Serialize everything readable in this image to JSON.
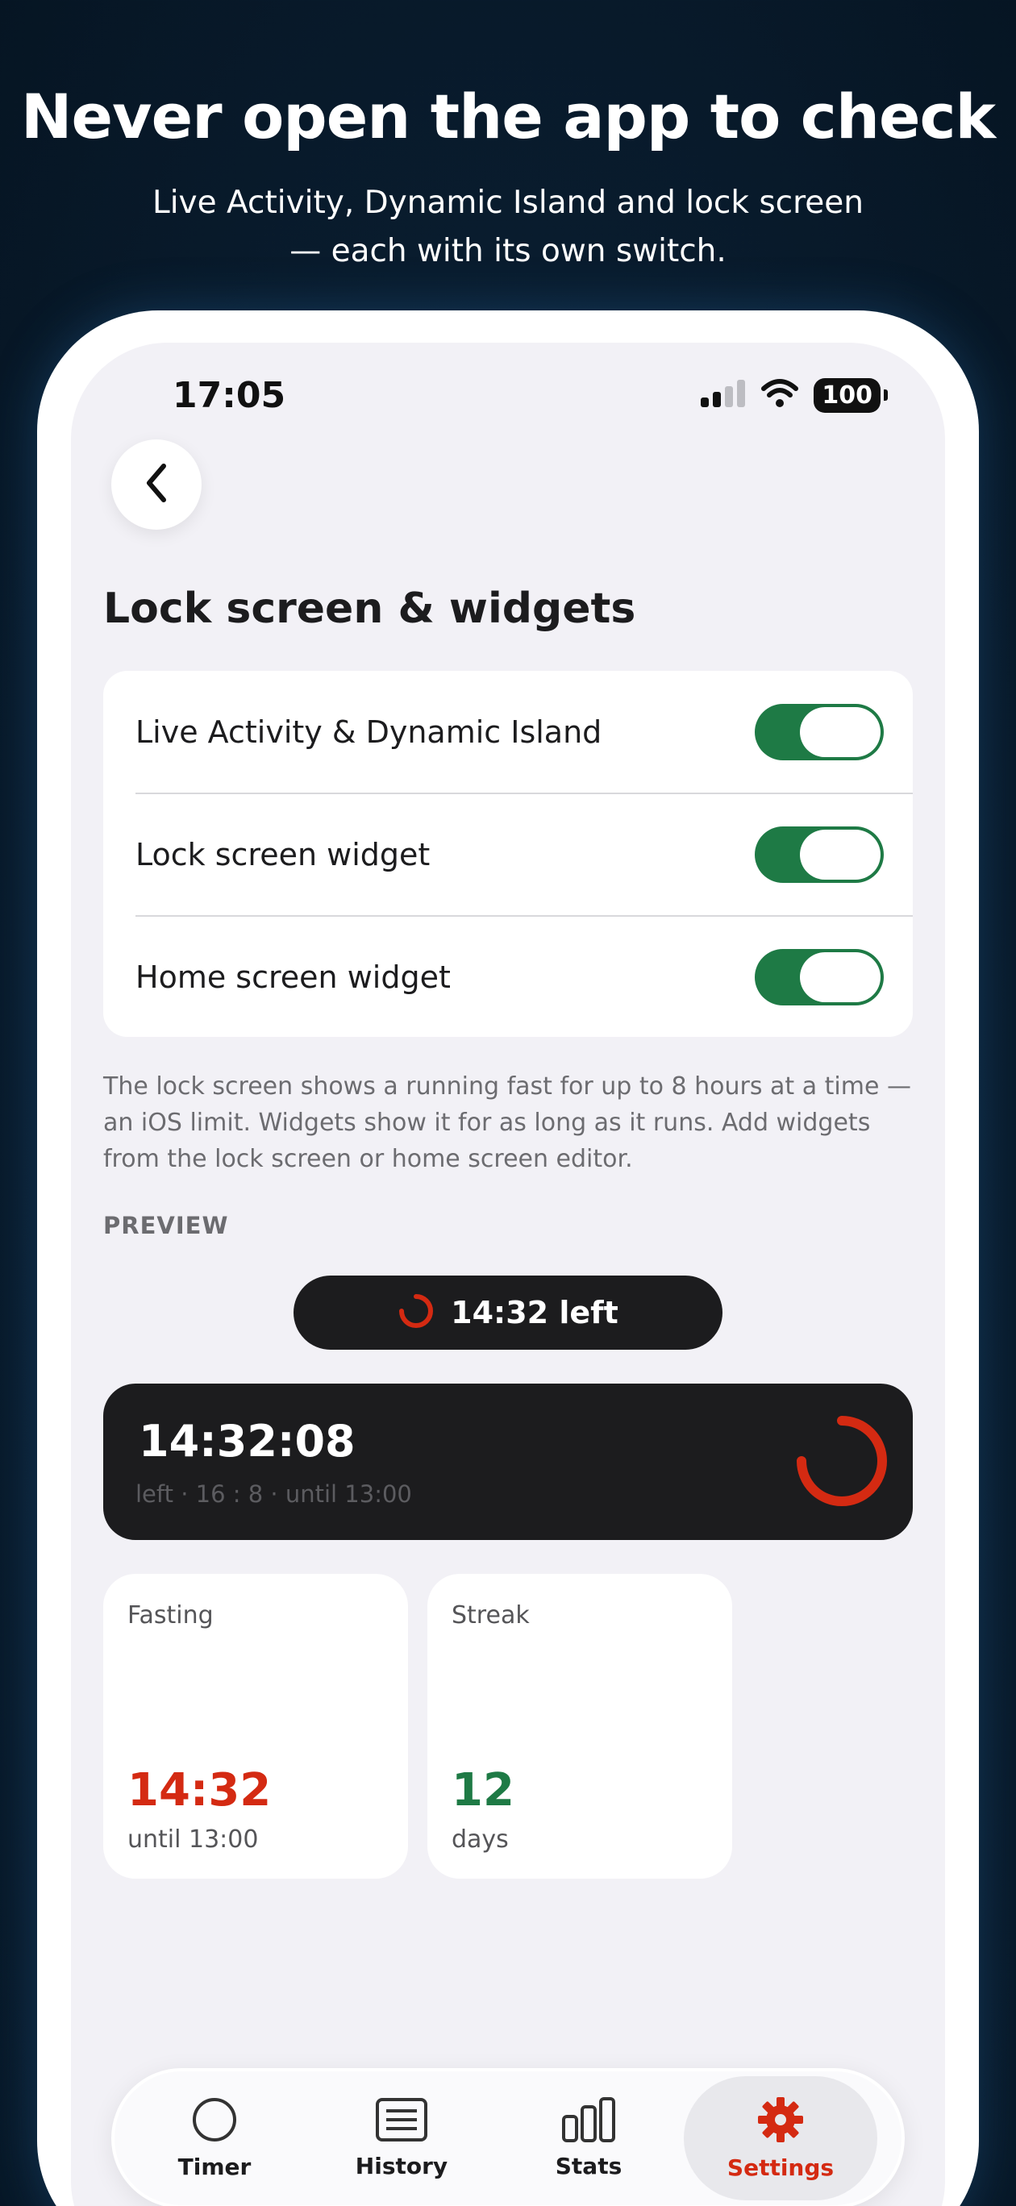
{
  "header": {
    "headline": "Never open the app to check",
    "subline_1": "Live Activity, Dynamic Island and lock screen",
    "subline_2": "— each with its own switch."
  },
  "status_bar": {
    "time": "17:05",
    "battery": "100"
  },
  "page": {
    "title": "Lock screen & widgets"
  },
  "settings": [
    {
      "label": "Live Activity & Dynamic Island",
      "enabled": true
    },
    {
      "label": "Lock screen widget",
      "enabled": true
    },
    {
      "label": "Home screen widget",
      "enabled": true
    }
  ],
  "footnote": "The lock screen shows a running fast for up to 8 hours at a time — an iOS limit. Widgets show it for as long as it runs. Add widgets from the lock screen or home screen editor.",
  "preview": {
    "header": "PREVIEW",
    "island_text": "14:32 left",
    "live_time": "14:32:08",
    "live_sub": "left · 16 : 8 · until 13:00",
    "widgets": [
      {
        "title": "Fasting",
        "value": "14:32",
        "sub": "until 13:00",
        "color": "#d42a12"
      },
      {
        "title": "Streak",
        "value": "12",
        "sub": "days",
        "color": "#1e7a45"
      }
    ]
  },
  "tabs": [
    {
      "label": "Timer",
      "icon": "circle-icon"
    },
    {
      "label": "History",
      "icon": "list-icon"
    },
    {
      "label": "Stats",
      "icon": "bar-chart-icon"
    },
    {
      "label": "Settings",
      "icon": "gear-icon",
      "active": true
    }
  ],
  "colors": {
    "accent_red": "#d42a12",
    "toggle_green": "#1e7a45",
    "dark_card": "#1c1c1e"
  }
}
